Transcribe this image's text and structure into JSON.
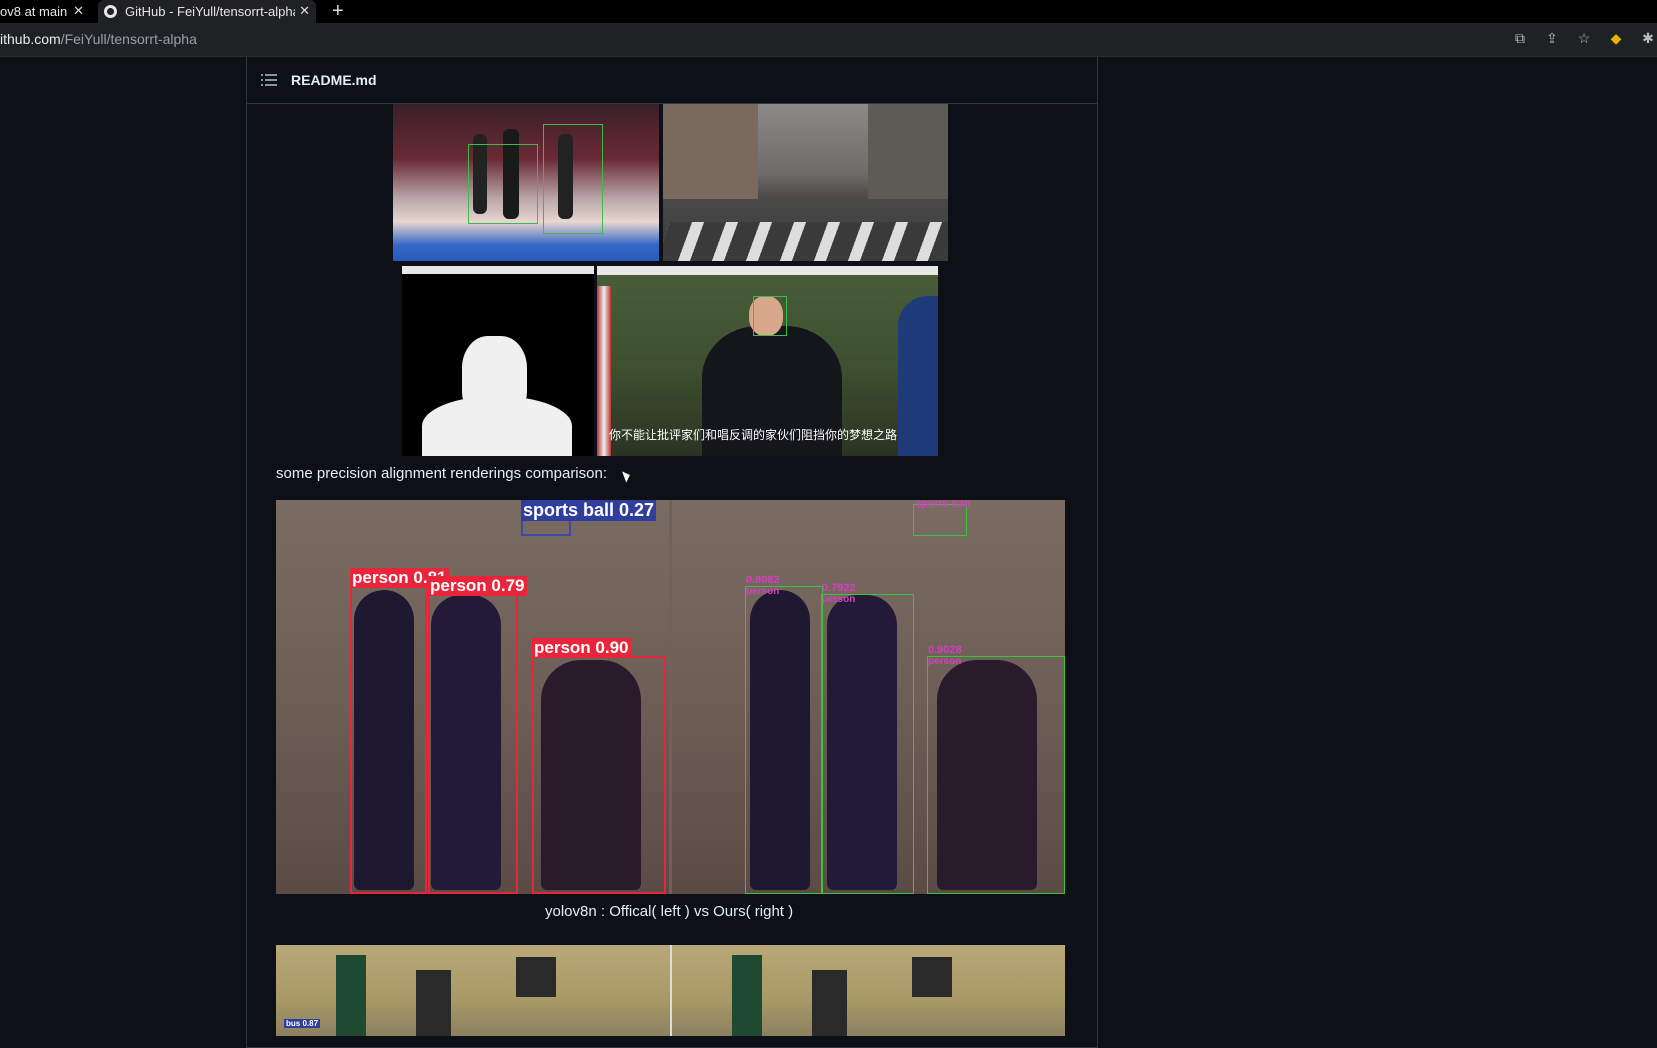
{
  "browser": {
    "tabs": [
      {
        "label": "ov8 at main"
      },
      {
        "label": "GitHub - FeiYull/tensorrt-alpha"
      }
    ],
    "url_host": "ithub.com",
    "url_path": "/FeiYull/tensorrt-alpha"
  },
  "readme": {
    "title": "README.md",
    "comparison_text": "some precision alignment renderings comparison:",
    "caption": "yolov8n : Offical( left ) vs Ours( right )",
    "subtitle_text": "你不能让批评家们和唱反调的家伙们阻挡你的梦想之路",
    "labels_left": [
      "sports ball 0.27",
      "person 0.81",
      "person 0.79",
      "person 0.90"
    ],
    "labels_right": [
      "sports ball",
      "0.8082",
      "0.7922",
      "0.9028"
    ],
    "right_class": "person",
    "bus_label": "bus 0.87"
  },
  "colors": {
    "bg": "#0d1117",
    "official_box": "#e8253b",
    "ours_box": "#38c33a"
  }
}
